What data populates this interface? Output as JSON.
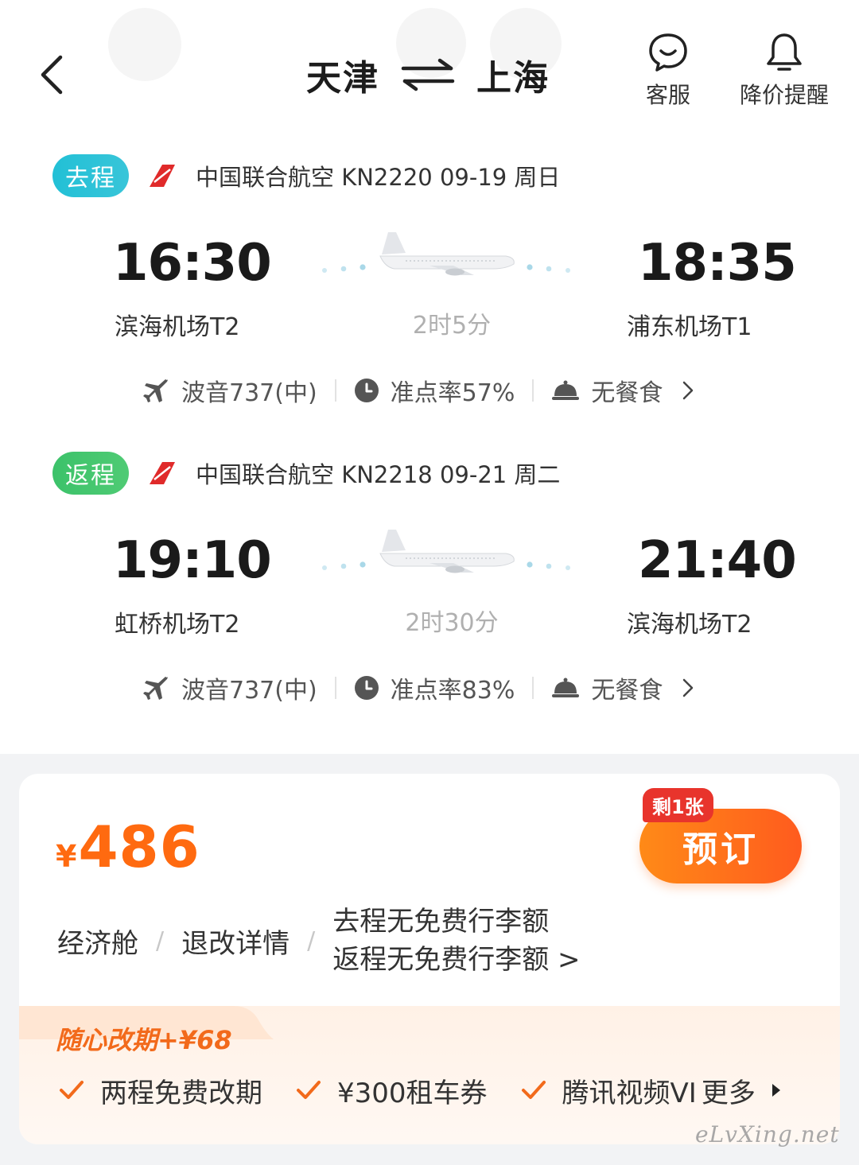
{
  "header": {
    "from_city": "天津",
    "to_city": "上海",
    "customer_service_label": "客服",
    "price_alert_label": "降价提醒"
  },
  "outbound": {
    "tag": "去程",
    "info": "中国联合航空 KN2220  09-19 周日",
    "dep_time": "16:30",
    "dep_airport": "滨海机场T2",
    "arr_time": "18:35",
    "arr_airport": "浦东机场T1",
    "duration": "2时5分",
    "aircraft": "波音737(中)",
    "ontime": "准点率57%",
    "meal": "无餐食"
  },
  "return": {
    "tag": "返程",
    "info": "中国联合航空 KN2218  09-21 周二",
    "dep_time": "19:10",
    "dep_airport": "虹桥机场T2",
    "arr_time": "21:40",
    "arr_airport": "滨海机场T2",
    "duration": "2时30分",
    "aircraft": "波音737(中)",
    "ontime": "准点率83%",
    "meal": "无餐食"
  },
  "fare": {
    "currency": "¥",
    "price": "486",
    "remaining": "剩1张",
    "book_label": "预订",
    "cabin": "经济舱",
    "refund_details": "退改详情",
    "baggage_out": "去程无免费行李额",
    "baggage_back": "返程无免费行李额 >"
  },
  "promo": {
    "title": "随心改期+¥68",
    "benefits": [
      "两程免费改期",
      "¥300租车券",
      "腾讯视频VI"
    ],
    "more_label": "更多"
  },
  "watermark": "eLvXing.net",
  "colors": {
    "accent_orange": "#ff6a10",
    "tag_outbound": "#22c0d6",
    "tag_return": "#3cc26a",
    "remain_badge": "#e8342c"
  }
}
